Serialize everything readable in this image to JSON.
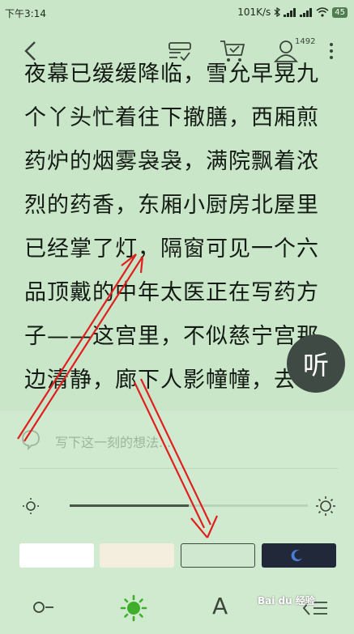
{
  "status_bar": {
    "time": "下午3:14",
    "network_speed": "101K/s",
    "battery": "45"
  },
  "toolbar": {
    "user_count": "1492"
  },
  "reading": {
    "lines": [
      "夜幕已缓缓降临，雪允早晃九",
      "个丫头忙着往下撤膳，西厢煎",
      "药炉的烟雾袅袅，满院飘着浓",
      "烈的药香，东厢小厨房北屋里",
      "已经掌了灯，隔窗可见一个六",
      "品顶戴的中年太医正在写药方",
      "子——这宫里，不似慈宁宫那",
      "边清静，廊下人影幢幢，去"
    ],
    "listen_label": "听"
  },
  "panel": {
    "thought_placeholder": "写下这一刻的想法...",
    "brightness_level": 0.5,
    "themes": [
      "white",
      "cream",
      "green",
      "night"
    ],
    "selected_theme": "green",
    "font_label": "A"
  },
  "colors": {
    "background": "#c9e6c9",
    "panel": "#d0ead0",
    "accent_green": "#3fae2a",
    "annotation_red": "#e02020"
  },
  "watermark": "Bai du 经验"
}
